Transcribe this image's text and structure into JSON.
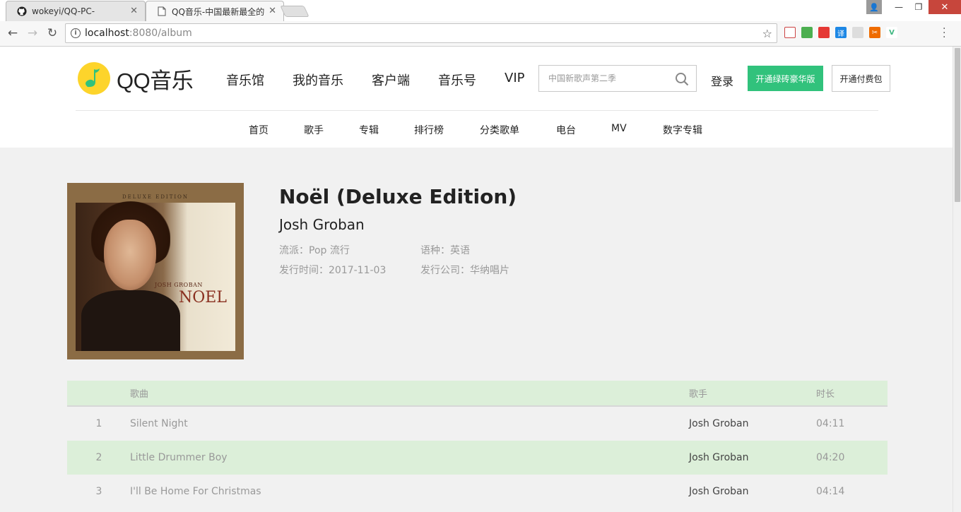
{
  "browser": {
    "tabs": [
      {
        "title": "wokeyi/QQ-PC-",
        "icon": "github-icon"
      },
      {
        "title": "QQ音乐-中国最新最全的",
        "icon": "page-icon"
      }
    ],
    "address": {
      "host": "localhost",
      "path": ":8080/album"
    }
  },
  "header": {
    "logo_text": "QQ音乐",
    "nav": [
      "音乐馆",
      "我的音乐",
      "客户端",
      "音乐号",
      "VIP"
    ],
    "search_placeholder": "中国新歌声第二季",
    "login": "登录",
    "vip_button": "开通绿砖豪华版",
    "paid_button": "开通付费包",
    "subnav": [
      "首页",
      "歌手",
      "专辑",
      "排行榜",
      "分类歌单",
      "电台",
      "MV",
      "数字专辑"
    ]
  },
  "album": {
    "title": "Noël (Deluxe Edition)",
    "artist": "Josh Groban",
    "genre": "流派：Pop 流行",
    "language": "语种：英语",
    "release": "发行时间：2017-11-03",
    "company": "发行公司：华纳唱片",
    "cover": {
      "band_text": "DELUXE EDITION",
      "artist_text": "JOSH GROBAN",
      "title_text": "NOEL"
    }
  },
  "songs": {
    "headers": {
      "song": "歌曲",
      "singer": "歌手",
      "duration": "时长"
    },
    "rows": [
      {
        "num": "1",
        "name": "Silent Night",
        "singer": "Josh Groban",
        "time": "04:11"
      },
      {
        "num": "2",
        "name": "Little Drummer Boy",
        "singer": "Josh Groban",
        "time": "04:20"
      },
      {
        "num": "3",
        "name": "I'll Be Home For Christmas",
        "singer": "Josh Groban",
        "time": "04:14"
      }
    ]
  },
  "colors": {
    "accent_green": "#31c27c",
    "row_highlight": "#dcefd9"
  }
}
